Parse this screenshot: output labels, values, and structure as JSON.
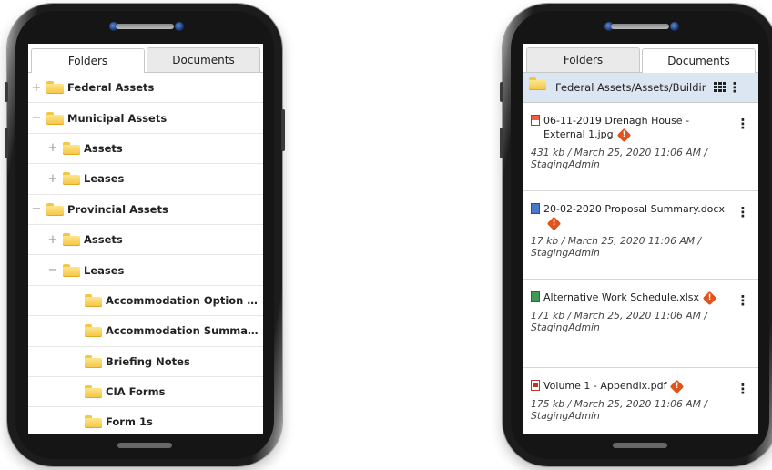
{
  "left": {
    "tabs": [
      {
        "label": "Folders",
        "active": true
      },
      {
        "label": "Documents",
        "active": false
      }
    ],
    "tree": [
      {
        "label": "Federal Assets",
        "toggle": "+",
        "level": 0
      },
      {
        "label": "Municipal Assets",
        "toggle": "−",
        "level": 0
      },
      {
        "label": "Assets",
        "toggle": "+",
        "level": 1
      },
      {
        "label": "Leases",
        "toggle": "+",
        "level": 1
      },
      {
        "label": "Provincial Assets",
        "toggle": "−",
        "level": 0
      },
      {
        "label": "Assets",
        "toggle": "+",
        "level": 1
      },
      {
        "label": "Leases",
        "toggle": "−",
        "level": 1
      },
      {
        "label": "Accommodation Option R...",
        "toggle": "",
        "level": 2
      },
      {
        "label": "Accommodation Summary...",
        "toggle": "",
        "level": 2
      },
      {
        "label": "Briefing Notes",
        "toggle": "",
        "level": 2
      },
      {
        "label": "CIA Forms",
        "toggle": "",
        "level": 2
      },
      {
        "label": "Form 1s",
        "toggle": "",
        "level": 2
      }
    ]
  },
  "right": {
    "tabs": [
      {
        "label": "Folders",
        "active": false
      },
      {
        "label": "Documents",
        "active": true
      }
    ],
    "path": "Federal Assets/Assets/Building",
    "documents": [
      {
        "name": "06-11-2019 Drenagh House - External 1.jpg",
        "type": "jpg",
        "meta": "431 kb / March 25, 2020 11:06 AM / StagingAdmin"
      },
      {
        "name": "20-02-2020 Proposal Summary.docx",
        "type": "docx",
        "meta": "17 kb / March 25, 2020 11:06 AM / StagingAdmin"
      },
      {
        "name": "Alternative Work Schedule.xlsx",
        "type": "xlsx",
        "meta": "171 kb / March 25, 2020 11:06 AM / StagingAdmin"
      },
      {
        "name": "Volume 1 - Appendix.pdf",
        "type": "pdf",
        "meta": "175 kb / March 25, 2020 11:06 AM / StagingAdmin"
      }
    ]
  },
  "icons": {
    "folder": "folder-icon",
    "warning": "warning-icon",
    "grid": "grid-view-icon",
    "menu": "more-vertical-icon"
  },
  "colors": {
    "path_bar": "#dce6f2",
    "folder": "#f4c542",
    "warning": "#e0531b"
  }
}
